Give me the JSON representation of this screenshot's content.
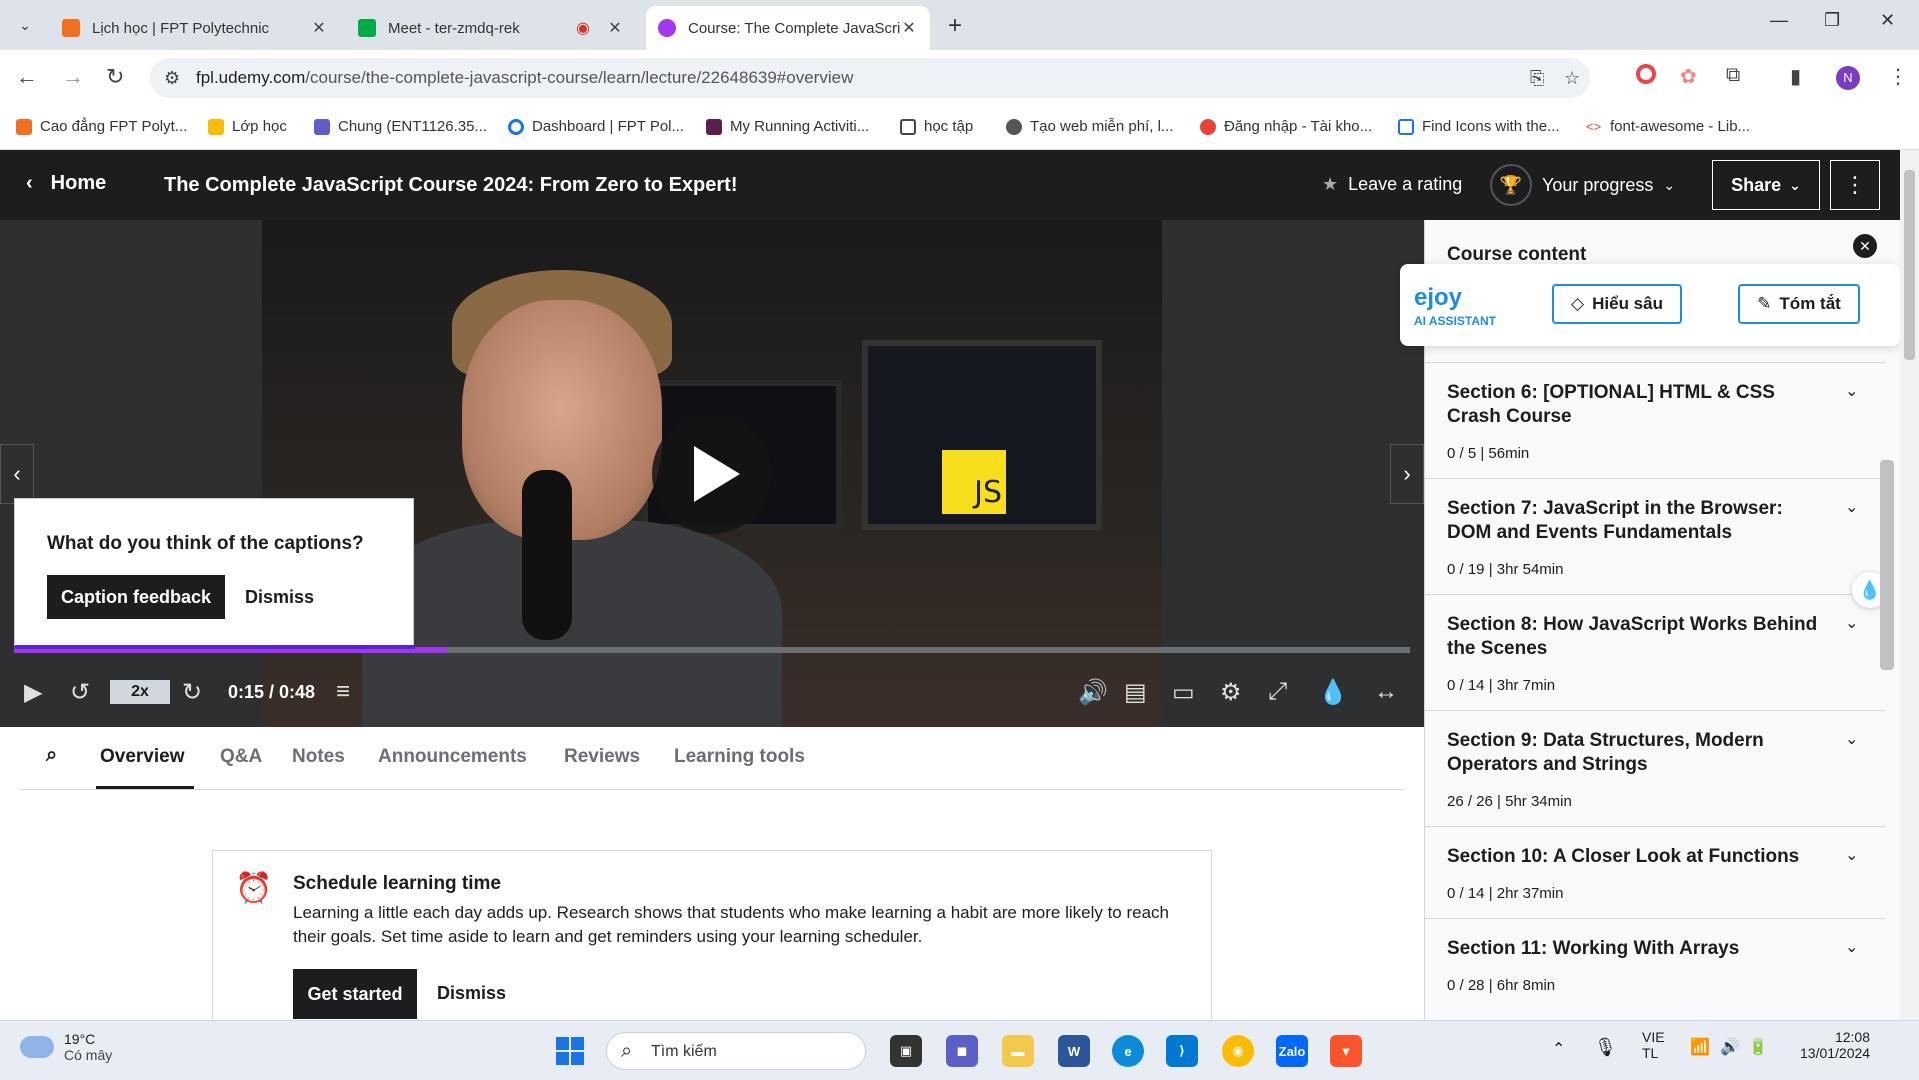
{
  "browser": {
    "tabs": [
      {
        "title": "Lịch học | FPT Polytechnic",
        "color": "#f37021"
      },
      {
        "title": "Meet - ter-zmdq-rek",
        "color": "#00ac47"
      },
      {
        "title": "Course: The Complete JavaScrip",
        "color": "#a435f0",
        "active": true
      }
    ],
    "url_host": "fpl.udemy.com",
    "url_path": "/course/the-complete-javascript-course/learn/lecture/22648639#overview",
    "profile_initial": "N",
    "bookmarks": [
      "Cao đẳng FPT Polyt...",
      "Lớp học",
      "Chung (ENT1126.35...",
      "Dashboard | FPT Pol...",
      "My Running Activiti...",
      "học tập",
      "Tạo web miễn phí, l...",
      "Đăng nhập - Tài kho...",
      "Find Icons with the...",
      "font-awesome - Lib..."
    ]
  },
  "header": {
    "home": "Home",
    "course_title": "The Complete JavaScript Course 2024: From Zero to Expert!",
    "rating": "Leave a rating",
    "progress": "Your progress",
    "share": "Share"
  },
  "player": {
    "speed": "2x",
    "time": "0:15 / 0:48",
    "progress_fraction": 0.31,
    "js_badge": "JS",
    "caption_popup": {
      "question": "What do you think of the captions?",
      "feedback": "Caption feedback",
      "dismiss": "Dismiss"
    }
  },
  "course_tabs": [
    "Overview",
    "Q&A",
    "Notes",
    "Announcements",
    "Reviews",
    "Learning tools"
  ],
  "schedule": {
    "title": "Schedule learning time",
    "body": "Learning a little each day adds up. Research shows that students who make learning a habit are more likely to reach their goals. Set time aside to learn and get reminders using your learning scheduler.",
    "cta": "Get started",
    "dismiss": "Dismiss"
  },
  "sidebar": {
    "title": "Course content",
    "ejoy": {
      "brand": "ejoy",
      "sub": "AI ASSISTANT",
      "btn1": "Hiểu sâu",
      "btn2": "Tóm tắt"
    },
    "sections": [
      {
        "title": "Section 6: [OPTIONAL] HTML & CSS Crash Course",
        "meta": "0 / 5 | 56min"
      },
      {
        "title": "Section 7: JavaScript in the Browser: DOM and Events Fundamentals",
        "meta": "0 / 19 | 3hr 54min"
      },
      {
        "title": "Section 8: How JavaScript Works Behind the Scenes",
        "meta": "0 / 14 | 3hr 7min"
      },
      {
        "title": "Section 9: Data Structures, Modern Operators and Strings",
        "meta": "26 / 26 | 5hr 34min"
      },
      {
        "title": "Section 10: A Closer Look at Functions",
        "meta": "0 / 14 | 2hr 37min"
      },
      {
        "title": "Section 11: Working With Arrays",
        "meta": "0 / 28 | 6hr 8min"
      }
    ]
  },
  "taskbar": {
    "temp": "19°C",
    "weather": "Có mây",
    "search": "Tìm kiếm",
    "lang1": "VIE",
    "lang2": "TL",
    "time": "12:08",
    "date": "13/01/2024"
  }
}
